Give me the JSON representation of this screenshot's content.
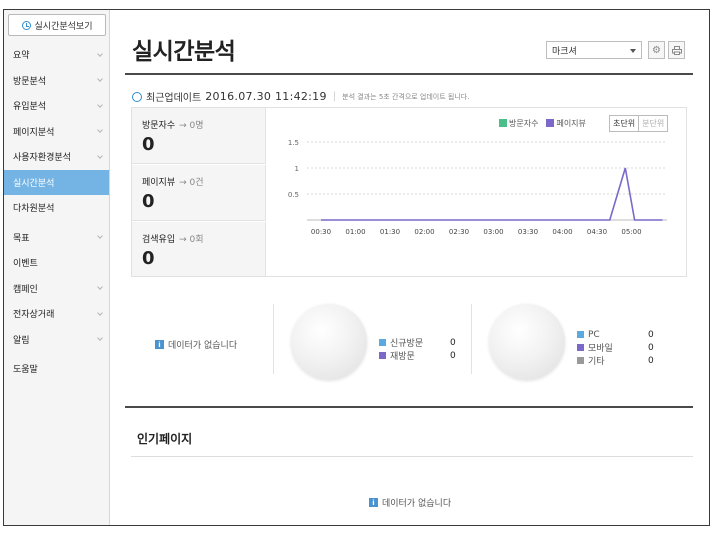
{
  "sidebar": {
    "realtime_button": "실시간분석보기",
    "items": [
      {
        "label": "요약",
        "chevron": true
      },
      {
        "label": "방문분석",
        "chevron": true
      },
      {
        "label": "유입분석",
        "chevron": true
      },
      {
        "label": "페이지분석",
        "chevron": true
      },
      {
        "label": "사용자환경분석",
        "chevron": true
      },
      {
        "label": "실시간분석",
        "chevron": false,
        "active": true
      },
      {
        "label": "다차원분석",
        "chevron": false
      },
      {
        "label": "목표",
        "chevron": true
      },
      {
        "label": "이벤트",
        "chevron": false
      },
      {
        "label": "캠페인",
        "chevron": true
      },
      {
        "label": "전자상거래",
        "chevron": true
      },
      {
        "label": "알림",
        "chevron": true
      },
      {
        "label": "도움말",
        "chevron": false
      }
    ]
  },
  "header": {
    "title": "실시간분석",
    "market_select": "마크셔",
    "settings_icon": "gear-icon",
    "print_icon": "print-icon"
  },
  "update": {
    "label": "최근업데이트",
    "timestamp": "2016.07.30 11:42:19",
    "note": "분석 결과는 5초 간격으로 업데이트 됩니다."
  },
  "stats": [
    {
      "label": "방문자수",
      "sub": "→ 0명",
      "value": "0"
    },
    {
      "label": "페이지뷰",
      "sub": "→ 0건",
      "value": "0"
    },
    {
      "label": "검색유입",
      "sub": "→ 0회",
      "value": "0"
    }
  ],
  "legend": {
    "visitors": "방문자수",
    "pageviews": "페이지뷰"
  },
  "unit_toggle": {
    "seconds": "초단위",
    "minutes": "분단위"
  },
  "colors": {
    "visitors": "#4bbf8a",
    "pageviews": "#7b68c9",
    "accent": "#74b4e4",
    "pc": "#5aa9e0",
    "mobile": "#7b68c9",
    "other": "#999999"
  },
  "chart_data": {
    "type": "line",
    "x": [
      "00:30",
      "01:00",
      "01:30",
      "02:00",
      "02:30",
      "03:00",
      "03:30",
      "04:00",
      "04:30",
      "05:00"
    ],
    "yticks": [
      "1.5",
      "1",
      "0.5"
    ],
    "ylim": [
      0,
      1.5
    ],
    "series": [
      {
        "name": "페이지뷰",
        "points": [
          [
            0,
            0
          ],
          [
            0.93,
            0
          ],
          [
            0.98,
            1
          ],
          [
            1.01,
            0
          ],
          [
            1.1,
            0
          ]
        ]
      }
    ]
  },
  "visitor_types": {
    "nodata": "데이터가 없습니다",
    "items": [
      {
        "label": "신규방문",
        "value": "0"
      },
      {
        "label": "재방문",
        "value": "0"
      }
    ]
  },
  "devices": {
    "items": [
      {
        "label": "PC",
        "value": "0"
      },
      {
        "label": "모바일",
        "value": "0"
      },
      {
        "label": "기타",
        "value": "0"
      }
    ]
  },
  "popular": {
    "title": "인기페이지",
    "nodata": "데이터가 없습니다"
  }
}
